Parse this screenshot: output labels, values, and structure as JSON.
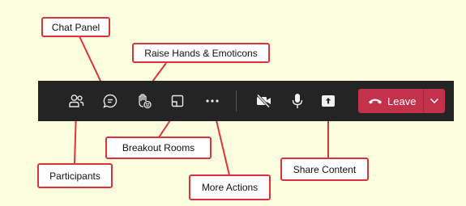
{
  "toolbar": {
    "icons": [
      {
        "name": "participants-icon",
        "label": "Participants"
      },
      {
        "name": "chat-icon",
        "label": "Chat Panel"
      },
      {
        "name": "raise-hand-icon",
        "label": "Raise Hands & Emoticons"
      },
      {
        "name": "breakout-rooms-icon",
        "label": "Breakout Rooms"
      },
      {
        "name": "more-actions-icon",
        "label": "More Actions"
      },
      {
        "name": "camera-off-icon"
      },
      {
        "name": "microphone-icon"
      },
      {
        "name": "share-content-icon",
        "label": "Share Content"
      }
    ],
    "leave_label": "Leave"
  },
  "callouts": {
    "chat_panel": "Chat Panel",
    "raise_hands": "Raise Hands & Emoticons",
    "breakout_rooms": "Breakout Rooms",
    "participants": "Participants",
    "more_actions": "More Actions",
    "share_content": "Share Content"
  },
  "colors": {
    "background": "#fdfde0",
    "toolbar": "#242424",
    "leave_button": "#c4314b",
    "callout_border": "#d9343b"
  }
}
